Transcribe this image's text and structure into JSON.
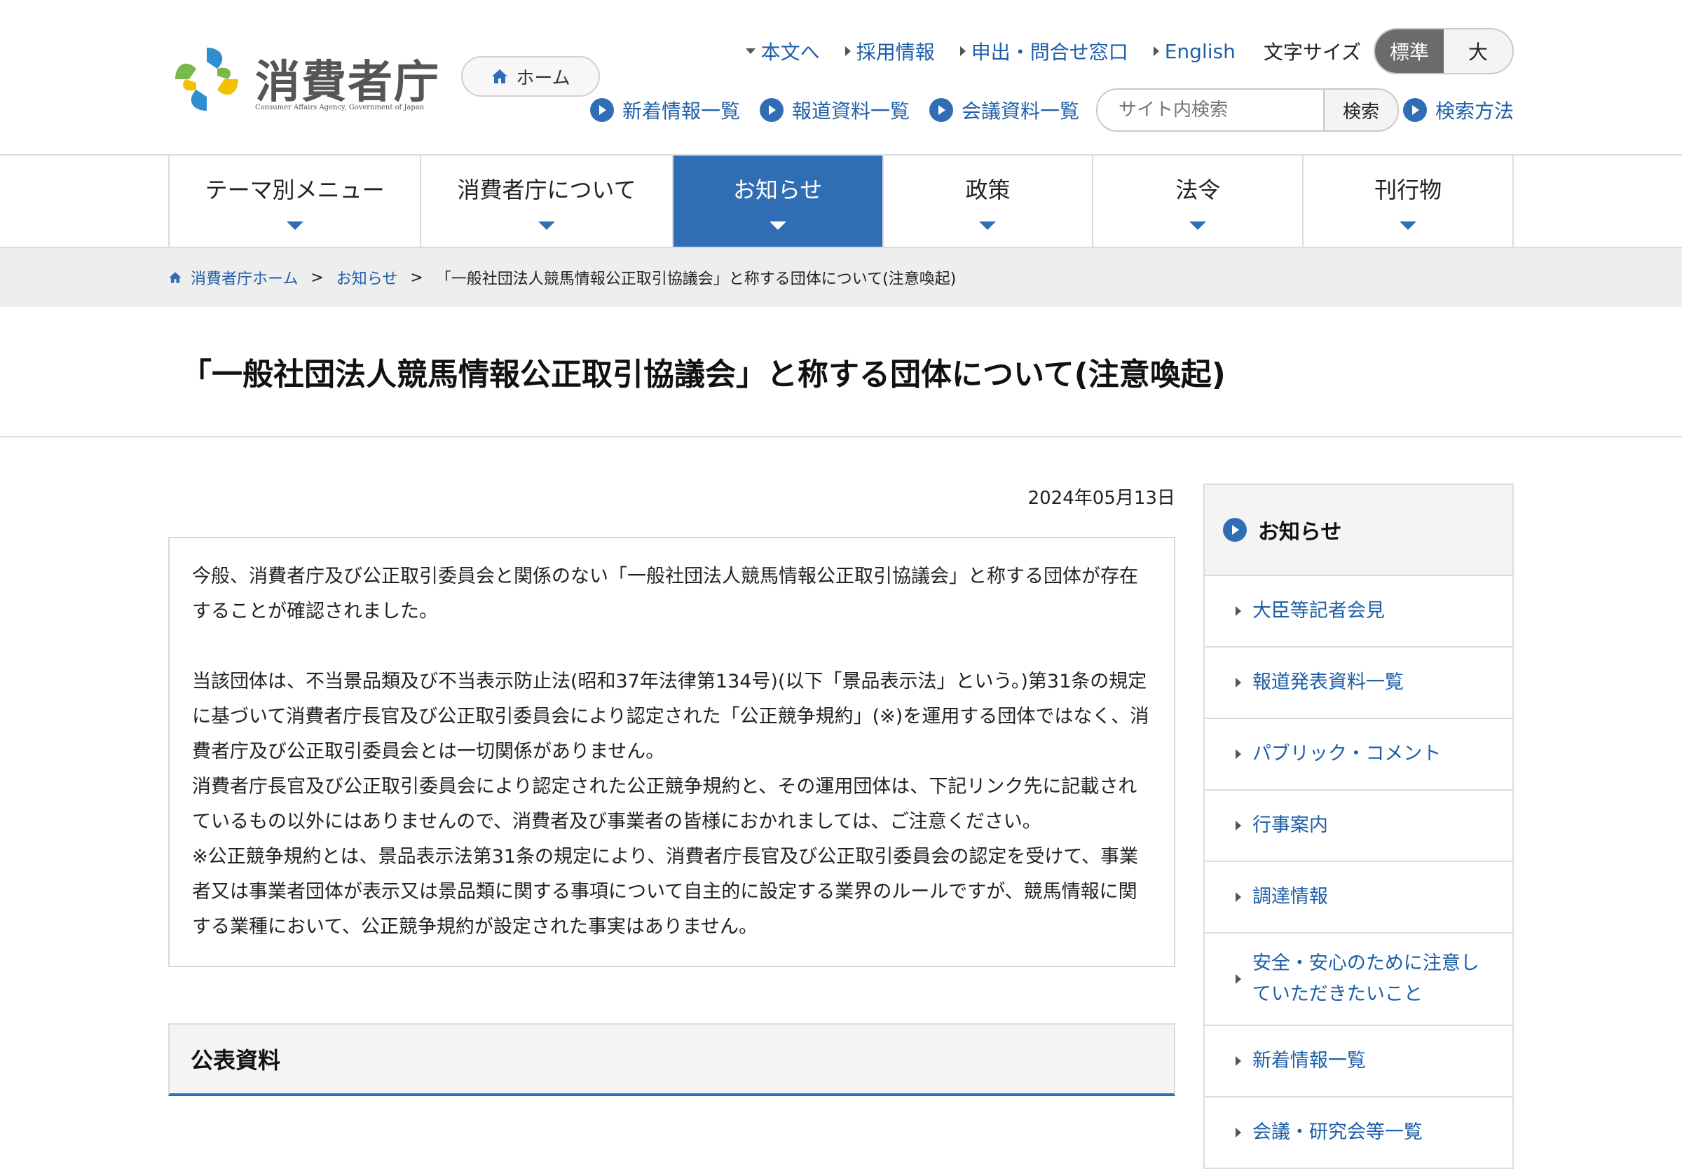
{
  "site": {
    "logo_text": "消費者庁",
    "logo_sub": "Consumer Affairs Agency, Government of Japan",
    "home_label": "ホーム"
  },
  "top_links": [
    {
      "label": "本文へ"
    },
    {
      "label": "採用情報"
    },
    {
      "label": "申出・問合せ窓口"
    },
    {
      "label": "English"
    }
  ],
  "font_size": {
    "label": "文字サイズ",
    "standard": "標準",
    "large": "大",
    "selected": "標準"
  },
  "quick_links": [
    {
      "label": "新着情報一覧"
    },
    {
      "label": "報道資料一覧"
    },
    {
      "label": "会議資料一覧"
    }
  ],
  "search": {
    "placeholder": "サイト内検索",
    "button": "検索",
    "help": "検索方法"
  },
  "gnav": [
    {
      "label": "テーマ別メニュー"
    },
    {
      "label": "消費者庁について"
    },
    {
      "label": "お知らせ"
    },
    {
      "label": "政策"
    },
    {
      "label": "法令"
    },
    {
      "label": "刊行物"
    }
  ],
  "breadcrumb": {
    "home": "消費者庁ホーム",
    "sep": ">",
    "parent": "お知らせ",
    "current": "「一般社団法人競馬情報公正取引協議会」と称する団体について(注意喚起)"
  },
  "page": {
    "title": "「一般社団法人競馬情報公正取引協議会」と称する団体について(注意喚起)",
    "date": "2024年05月13日",
    "paragraphs": [
      "今般、消費者庁及び公正取引委員会と関係のない「一般社団法人競馬情報公正取引協議会」と称する団体が存在することが確認されました。",
      "当該団体は、不当景品類及び不当表示防止法(昭和37年法律第134号)(以下「景品表示法」という。)第31条の規定に基づいて消費者庁長官及び公正取引委員会により認定された「公正競争規約」(※)を運用する団体ではなく、消費者庁及び公正取引委員会とは一切関係がありません。",
      "消費者庁長官及び公正取引委員会により認定された公正競争規約と、その運用団体は、下記リンク先に記載されているもの以外にはありませんので、消費者及び事業者の皆様におかれましては、ご注意ください。",
      "※公正競争規約とは、景品表示法第31条の規定により、消費者庁長官及び公正取引委員会の認定を受けて、事業者又は事業者団体が表示又は景品類に関する事項について自主的に設定する業界のルールですが、競馬情報に関する業種において、公正競争規約が設定された事実はありません。"
    ],
    "section_heading": "公表資料"
  },
  "sidebar": {
    "heading": "お知らせ",
    "items": [
      {
        "label": "大臣等記者会見"
      },
      {
        "label": "報道発表資料一覧"
      },
      {
        "label": "パブリック・コメント"
      },
      {
        "label": "行事案内"
      },
      {
        "label": "調達情報"
      },
      {
        "label": "安全・安心のために注意していただきたいこと"
      },
      {
        "label": "新着情報一覧"
      },
      {
        "label": "会議・研究会等一覧"
      }
    ]
  },
  "colors": {
    "accent": "#2f6db5",
    "link": "#1e5fa8"
  }
}
